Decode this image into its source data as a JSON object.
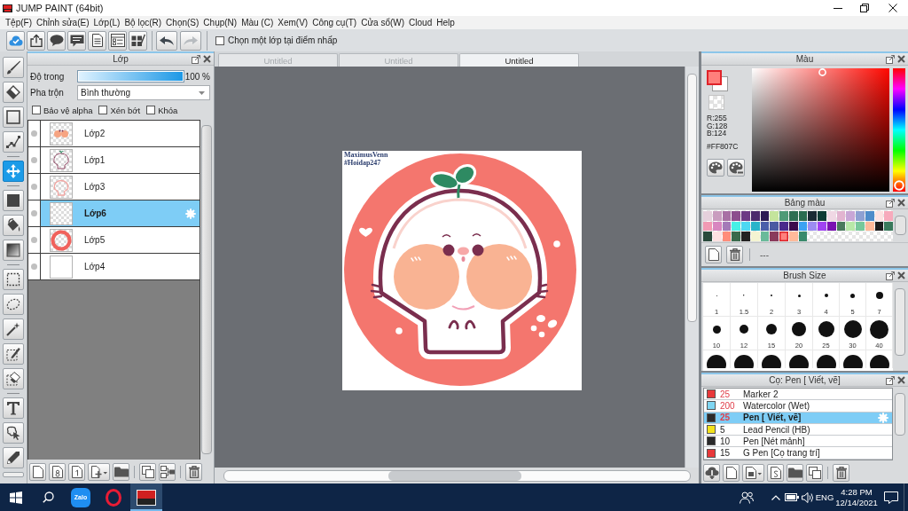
{
  "window": {
    "title": "JUMP PAINT (64bit)"
  },
  "menu": [
    "Tệp(F)",
    "Chỉnh sửa(E)",
    "Lớp(L)",
    "Bộ lọc(R)",
    "Chọn(S)",
    "Chụp(N)",
    "Màu (C)",
    "Xem(V)",
    "Công cụ(T)",
    "Cửa sổ(W)",
    "Cloud",
    "Help"
  ],
  "toolbar": {
    "history": [
      {
        "disabled": false
      },
      {
        "disabled": true
      }
    ],
    "pick_layer": {
      "label": "Chọn một lớp tại điểm nhấp",
      "checked": false
    }
  },
  "tools": [
    {
      "selected": false
    },
    {
      "selected": false
    },
    {
      "selected": false
    },
    {
      "selected": false
    },
    {
      "selected": true
    },
    {
      "selected": false
    },
    {
      "selected": false
    },
    {
      "selected": false
    },
    {
      "selected": false
    },
    {
      "selected": false
    },
    {
      "selected": false
    },
    {
      "selected": false
    },
    {
      "selected": false
    },
    {
      "selected": false
    },
    {
      "selected": false
    },
    {
      "selected": false
    }
  ],
  "layer_panel": {
    "title": "Lớp",
    "opacity": {
      "label": "Độ trong",
      "level": 1,
      "reading": "100 %"
    },
    "blend": {
      "label": "Pha trộn",
      "value": "Bình thường"
    },
    "options": [
      {
        "label": "Bảo vệ alpha",
        "checked": false
      },
      {
        "label": "Xén bớt",
        "checked": false
      },
      {
        "label": "Khóa",
        "checked": false
      }
    ],
    "layers": [
      {
        "name": "Lớp2",
        "selected": false
      },
      {
        "name": "Lớp1",
        "selected": false
      },
      {
        "name": "Lớp3",
        "selected": false
      },
      {
        "name": "Lớp6",
        "selected": true
      },
      {
        "name": "Lớp5",
        "selected": false
      },
      {
        "name": "Lớp4",
        "selected": false
      }
    ]
  },
  "document_tabs": [
    {
      "label": "Untitled",
      "selected": false
    },
    {
      "label": "Untitled",
      "selected": false
    },
    {
      "label": "Untitled",
      "selected": true
    }
  ],
  "canvas": {
    "signature": [
      "MaximusVenn",
      "#Hoidap247"
    ]
  },
  "color_panel": {
    "title": "Màu",
    "channels": [
      "R:255",
      "G:128",
      "B:124"
    ],
    "hex": "#FF807C",
    "hue_slider": {
      "level": 0.01
    }
  },
  "palette_panel": {
    "title": "Bảng màu",
    "swatches": [
      {
        "color": "#e5d0dc",
        "selected": false
      },
      {
        "color": "#c99dbf",
        "selected": false
      },
      {
        "color": "#a870a4",
        "selected": false
      },
      {
        "color": "#8c4e8e",
        "selected": false
      },
      {
        "color": "#6c3a84",
        "selected": false
      },
      {
        "color": "#4c2a6c",
        "selected": false
      },
      {
        "color": "#2c1a54",
        "selected": false
      },
      {
        "color": "#c4e49c",
        "selected": false
      },
      {
        "color": "#4e9a76",
        "selected": false
      },
      {
        "color": "#2e6e52",
        "selected": false
      },
      {
        "color": "#2a6c50",
        "selected": false
      },
      {
        "color": "#1a2a34",
        "selected": false
      },
      {
        "color": "#0e3a34",
        "selected": false
      },
      {
        "color": "#f0d8e4",
        "selected": false
      },
      {
        "color": "#e2b4d0",
        "selected": false
      },
      {
        "color": "#c8a6d6",
        "selected": false
      },
      {
        "color": "#8ea0d2",
        "selected": false
      },
      {
        "color": "#4e8cca",
        "selected": false
      },
      {
        "color": "#fde2e2",
        "selected": false
      },
      {
        "color": "#f7aabc",
        "selected": false
      },
      {
        "color": "#f29ab4",
        "selected": false
      },
      {
        "color": "#d886c0",
        "selected": false
      },
      {
        "color": "#a47ab8",
        "selected": false
      },
      {
        "color": "#46f0e6",
        "selected": false
      },
      {
        "color": "#4cd8f2",
        "selected": false
      },
      {
        "color": "#2ab4ca",
        "selected": false
      },
      {
        "color": "#4a5eaa",
        "selected": false
      },
      {
        "color": "#4a5aa2",
        "selected": false
      },
      {
        "color": "#4a2a8c",
        "selected": false
      },
      {
        "color": "#3c0c4c",
        "selected": false
      },
      {
        "color": "#3ca2f2",
        "selected": false
      },
      {
        "color": "#9c8cf2",
        "selected": false
      },
      {
        "color": "#a042f2",
        "selected": false
      },
      {
        "color": "#7a12b2",
        "selected": false
      },
      {
        "color": "#4a7a5c",
        "selected": false
      },
      {
        "color": "#b8e8a8",
        "selected": false
      },
      {
        "color": "#78c89a",
        "selected": false
      },
      {
        "color": "#ffba9a",
        "selected": false
      },
      {
        "color": "#1c1c1c",
        "selected": false
      },
      {
        "color": "#3a7a5c",
        "selected": false
      },
      {
        "color": "#2a4a3c",
        "selected": false
      },
      {
        "color": "#fde2e2",
        "selected": false
      },
      {
        "color": "#ff8c7a",
        "selected": false
      },
      {
        "color": "#3a6a4c",
        "selected": false
      },
      {
        "color": "#222222",
        "selected": false
      },
      {
        "color": "#f4f4d2",
        "selected": false
      },
      {
        "color": "#6aba9a",
        "selected": false
      },
      {
        "color": "#8a3a5c",
        "selected": false
      },
      {
        "color": "#ff807c",
        "selected": true
      },
      {
        "color": "#ffba9a",
        "selected": false
      },
      {
        "color": "#3a8a6c",
        "selected": false
      }
    ],
    "label": "---"
  },
  "brush_size_panel": {
    "title": "Brush Size",
    "sizes": [
      "1",
      "1.5",
      "2",
      "3",
      "4",
      "5",
      "7",
      "10",
      "12",
      "15",
      "20",
      "25",
      "30",
      "40"
    ]
  },
  "brush_panel": {
    "title": "Cọ: Pen [ Viết, vẽ]",
    "brushes": [
      {
        "color": "#e8383a",
        "size": "25",
        "size_highlighted": true,
        "name": "Marker 2",
        "selected": false
      },
      {
        "color": "#7fd6f2",
        "size": "200",
        "size_highlighted": true,
        "name": "Watercolor (Wet)",
        "selected": false
      },
      {
        "color": "#2a2a2a",
        "size": "25",
        "size_highlighted": true,
        "name": "Pen [ Viết, vẽ]",
        "selected": true
      },
      {
        "color": "#f2e21c",
        "size": "5",
        "size_highlighted": false,
        "name": "Lead Pencil (HB)",
        "selected": false
      },
      {
        "color": "#2a2a2a",
        "size": "10",
        "size_highlighted": false,
        "name": "Pen [Nét mảnh]",
        "selected": false
      },
      {
        "color": "#e8383a",
        "size": "15",
        "size_highlighted": false,
        "name": "G Pen [Cọ trang trí]",
        "selected": false
      }
    ]
  },
  "taskbar": {
    "apps": [
      {
        "kind": "zalo",
        "logo_text": "Zalo",
        "selected": false
      },
      {
        "kind": "opera",
        "selected": false
      },
      {
        "kind": "paint",
        "selected": true
      }
    ],
    "language": "ENG",
    "time": "4:28 PM",
    "date": "12/14/2021"
  }
}
